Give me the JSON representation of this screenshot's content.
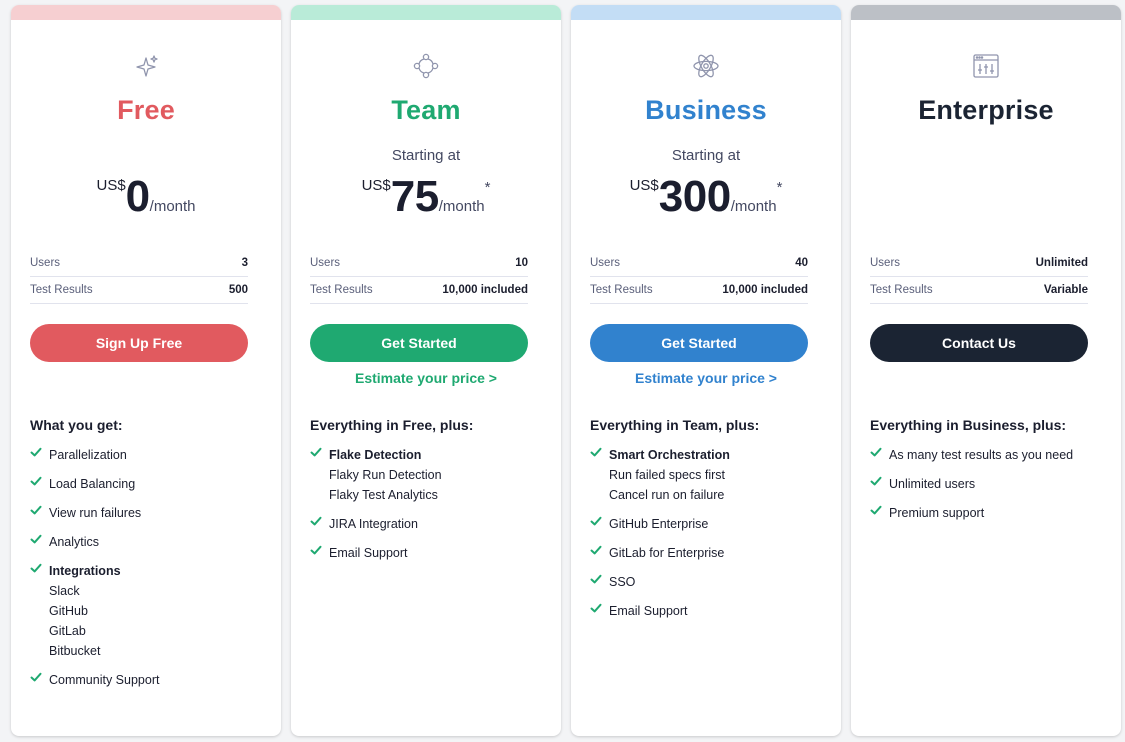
{
  "plans": [
    {
      "name": "Free",
      "accent": "#e15a5f",
      "bar_color": "#f6cfd1",
      "icon": "sparkle-icon",
      "starting_at": "",
      "currency": "US$",
      "amount": "0",
      "period": "/month",
      "asterisk": "",
      "users_label": "Users",
      "users_value": "3",
      "results_label": "Test Results",
      "results_value": "500",
      "button_label": "Sign Up Free",
      "button_color": "#e15a5f",
      "estimate_label": "",
      "features_heading": "What you get:",
      "features": [
        {
          "title": "Parallelization",
          "bold": false,
          "subs": []
        },
        {
          "title": "Load Balancing",
          "bold": false,
          "subs": []
        },
        {
          "title": "View run failures",
          "bold": false,
          "subs": []
        },
        {
          "title": "Analytics",
          "bold": false,
          "subs": []
        },
        {
          "title": "Integrations",
          "bold": true,
          "subs": [
            "Slack",
            "GitHub",
            "GitLab",
            "Bitbucket"
          ]
        },
        {
          "title": "Community Support",
          "bold": false,
          "subs": []
        }
      ]
    },
    {
      "name": "Team",
      "accent": "#1fa971",
      "bar_color": "#b9ebd8",
      "icon": "nodes-icon",
      "starting_at": "Starting at",
      "currency": "US$",
      "amount": "75",
      "period": "/month",
      "asterisk": "*",
      "users_label": "Users",
      "users_value": "10",
      "results_label": "Test Results",
      "results_value": "10,000 included",
      "button_label": "Get Started",
      "button_color": "#1fa971",
      "estimate_label": "Estimate your price >",
      "features_heading": "Everything in Free, plus:",
      "features": [
        {
          "title": "Flake Detection",
          "bold": true,
          "subs": [
            "Flaky Run Detection",
            "Flaky Test Analytics"
          ]
        },
        {
          "title": "JIRA Integration",
          "bold": false,
          "subs": []
        },
        {
          "title": "Email Support",
          "bold": false,
          "subs": []
        }
      ]
    },
    {
      "name": "Business",
      "accent": "#3182ce",
      "bar_color": "#c3ddf5",
      "icon": "atom-icon",
      "starting_at": "Starting at",
      "currency": "US$",
      "amount": "300",
      "period": "/month",
      "asterisk": "*",
      "users_label": "Users",
      "users_value": "40",
      "results_label": "Test Results",
      "results_value": "10,000 included",
      "button_label": "Get Started",
      "button_color": "#3182ce",
      "estimate_label": "Estimate your price >",
      "features_heading": "Everything in Team, plus:",
      "features": [
        {
          "title": "Smart Orchestration",
          "bold": true,
          "subs": [
            "Run failed specs first",
            "Cancel run on failure"
          ]
        },
        {
          "title": "GitHub Enterprise",
          "bold": false,
          "subs": []
        },
        {
          "title": "GitLab for Enterprise",
          "bold": false,
          "subs": []
        },
        {
          "title": "SSO",
          "bold": false,
          "subs": []
        },
        {
          "title": "Email Support",
          "bold": false,
          "subs": []
        }
      ]
    },
    {
      "name": "Enterprise",
      "accent": "#1b2433",
      "bar_color": "#bcc0c6",
      "icon": "sliders-window-icon",
      "starting_at": "",
      "currency": "",
      "amount": "",
      "period": "",
      "asterisk": "",
      "users_label": "Users",
      "users_value": "Unlimited",
      "results_label": "Test Results",
      "results_value": "Variable",
      "button_label": "Contact Us",
      "button_color": "#1b2433",
      "estimate_label": "",
      "features_heading": "Everything in Business, plus:",
      "features": [
        {
          "title": "As many test results as you need",
          "bold": false,
          "subs": []
        },
        {
          "title": "Unlimited users",
          "bold": false,
          "subs": []
        },
        {
          "title": "Premium support",
          "bold": false,
          "subs": []
        }
      ]
    }
  ],
  "check_color": "#1fa971"
}
